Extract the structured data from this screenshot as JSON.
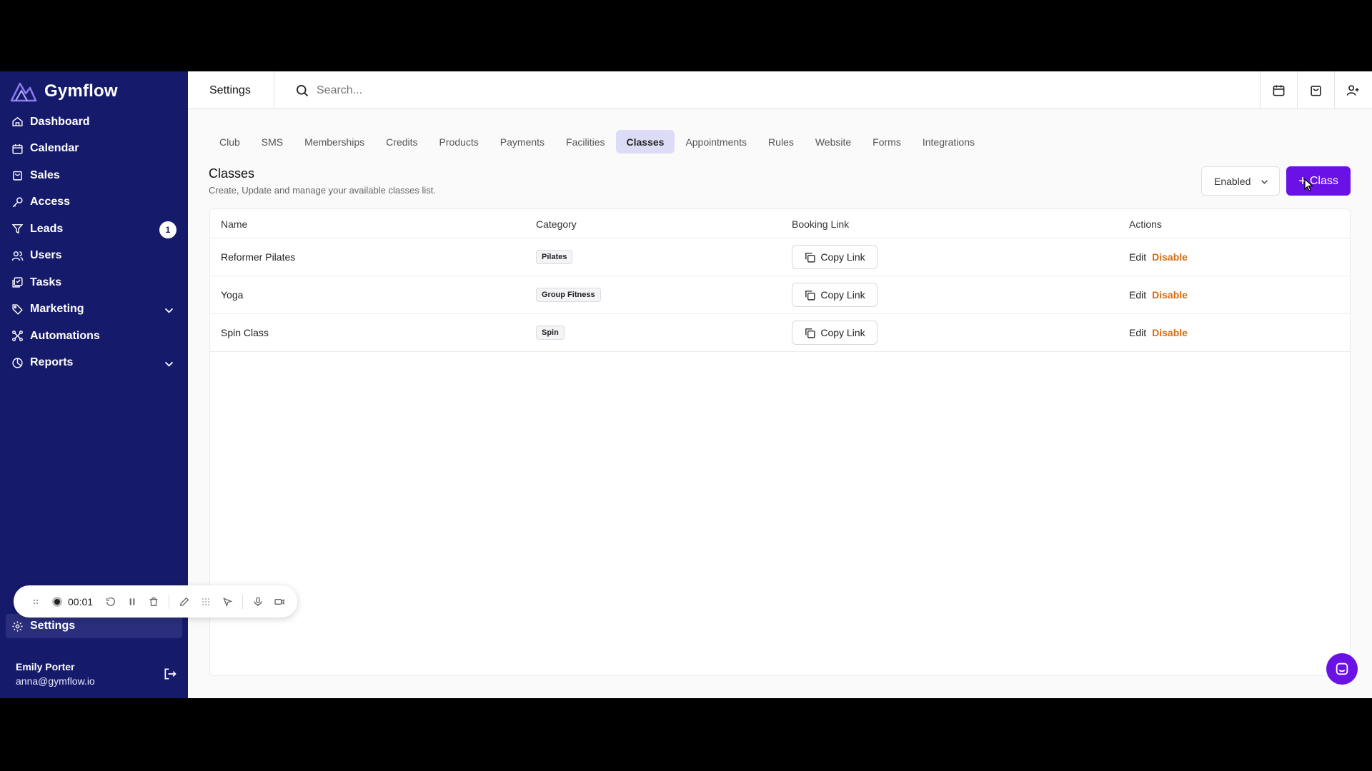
{
  "app": {
    "name": "Gymflow"
  },
  "sidebar": {
    "items": [
      {
        "label": "Dashboard"
      },
      {
        "label": "Calendar"
      },
      {
        "label": "Sales"
      },
      {
        "label": "Access"
      },
      {
        "label": "Leads",
        "badge": "1"
      },
      {
        "label": "Users"
      },
      {
        "label": "Tasks"
      },
      {
        "label": "Marketing"
      },
      {
        "label": "Automations"
      },
      {
        "label": "Reports"
      }
    ],
    "settings_label": "Settings",
    "user": {
      "name": "Emily Porter",
      "email": "anna@gymflow.io"
    }
  },
  "topbar": {
    "title": "Settings",
    "search_placeholder": "Search..."
  },
  "tabs": [
    "Club",
    "SMS",
    "Memberships",
    "Credits",
    "Products",
    "Payments",
    "Facilities",
    "Classes",
    "Appointments",
    "Rules",
    "Website",
    "Forms",
    "Integrations"
  ],
  "active_tab": "Classes",
  "section": {
    "title": "Classes",
    "subtitle": "Create, Update and manage your available classes list.",
    "status_filter": "Enabled",
    "add_label": "Class"
  },
  "table": {
    "headers": [
      "Name",
      "Category",
      "Booking Link",
      "Actions"
    ],
    "rows": [
      {
        "name": "Reformer Pilates",
        "category": "Pilates",
        "link_label": "Copy Link",
        "edit": "Edit",
        "disable": "Disable"
      },
      {
        "name": "Yoga",
        "category": "Group Fitness",
        "link_label": "Copy Link",
        "edit": "Edit",
        "disable": "Disable"
      },
      {
        "name": "Spin Class",
        "category": "Spin",
        "link_label": "Copy Link",
        "edit": "Edit",
        "disable": "Disable"
      }
    ]
  },
  "recorder": {
    "time": "00:01"
  },
  "colors": {
    "sidebar": "#161a6b",
    "accent": "#6a12e6",
    "disable": "#d96b12",
    "active_tab": "#dcdcf6"
  }
}
